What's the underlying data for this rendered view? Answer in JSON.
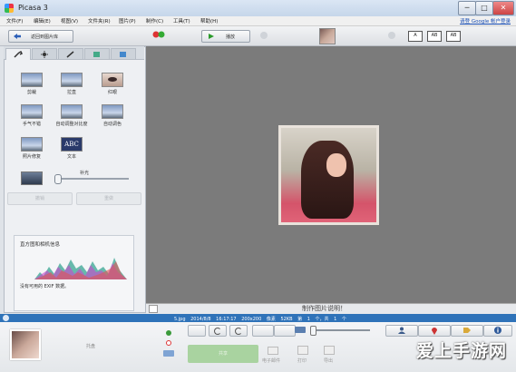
{
  "window": {
    "title": "Picasa 3",
    "min": "─",
    "max": "□",
    "close": "✕"
  },
  "menu": {
    "items": [
      "文件(F)",
      "编辑(E)",
      "视图(V)",
      "文件夹(R)",
      "图片(P)",
      "制作(C)",
      "工具(T)",
      "帮助(H)"
    ],
    "signin": "请登 Google 帐户登录"
  },
  "toolbar": {
    "back_label": "返回到图片库",
    "play_label": "播放",
    "caption_buttons": [
      "A",
      "AB",
      "AB"
    ]
  },
  "edit_panel": {
    "tools": [
      {
        "label": "剪裁",
        "icon": "crop-icon"
      },
      {
        "label": "拉直",
        "icon": "straighten-icon"
      },
      {
        "label": "红眼",
        "icon": "redeye-icon"
      },
      {
        "label": "手气不错",
        "icon": "lucky-icon"
      },
      {
        "label": "自动调整对比度",
        "icon": "contrast-icon"
      },
      {
        "label": "自动调色",
        "icon": "color-icon"
      },
      {
        "label": "照片修复",
        "icon": "retouch-icon"
      },
      {
        "label": "文本",
        "icon": "text-icon"
      }
    ],
    "text_tool_glyph": "ABC",
    "fill_light_label": "补光",
    "fill_light_value": 0.03,
    "apply_label": "撤销",
    "redo_label": "重做",
    "histogram_title": "直方图和相机信息",
    "exif_note": "没有可用的 EXIF 数据。"
  },
  "viewer": {
    "caption": "制作图片说明！"
  },
  "status": {
    "filename": "5.jpg",
    "date": "2014/8/8 16:17:17",
    "dims": "200x200 像素",
    "size": "52KB",
    "counter": "第 1 个，共 1 个"
  },
  "tray": {
    "hold_label": "托盘",
    "share_label": "共享",
    "email_label": "电子邮件",
    "print_label": "打印",
    "export_label": "导出"
  },
  "watermark": "爱上手游网"
}
